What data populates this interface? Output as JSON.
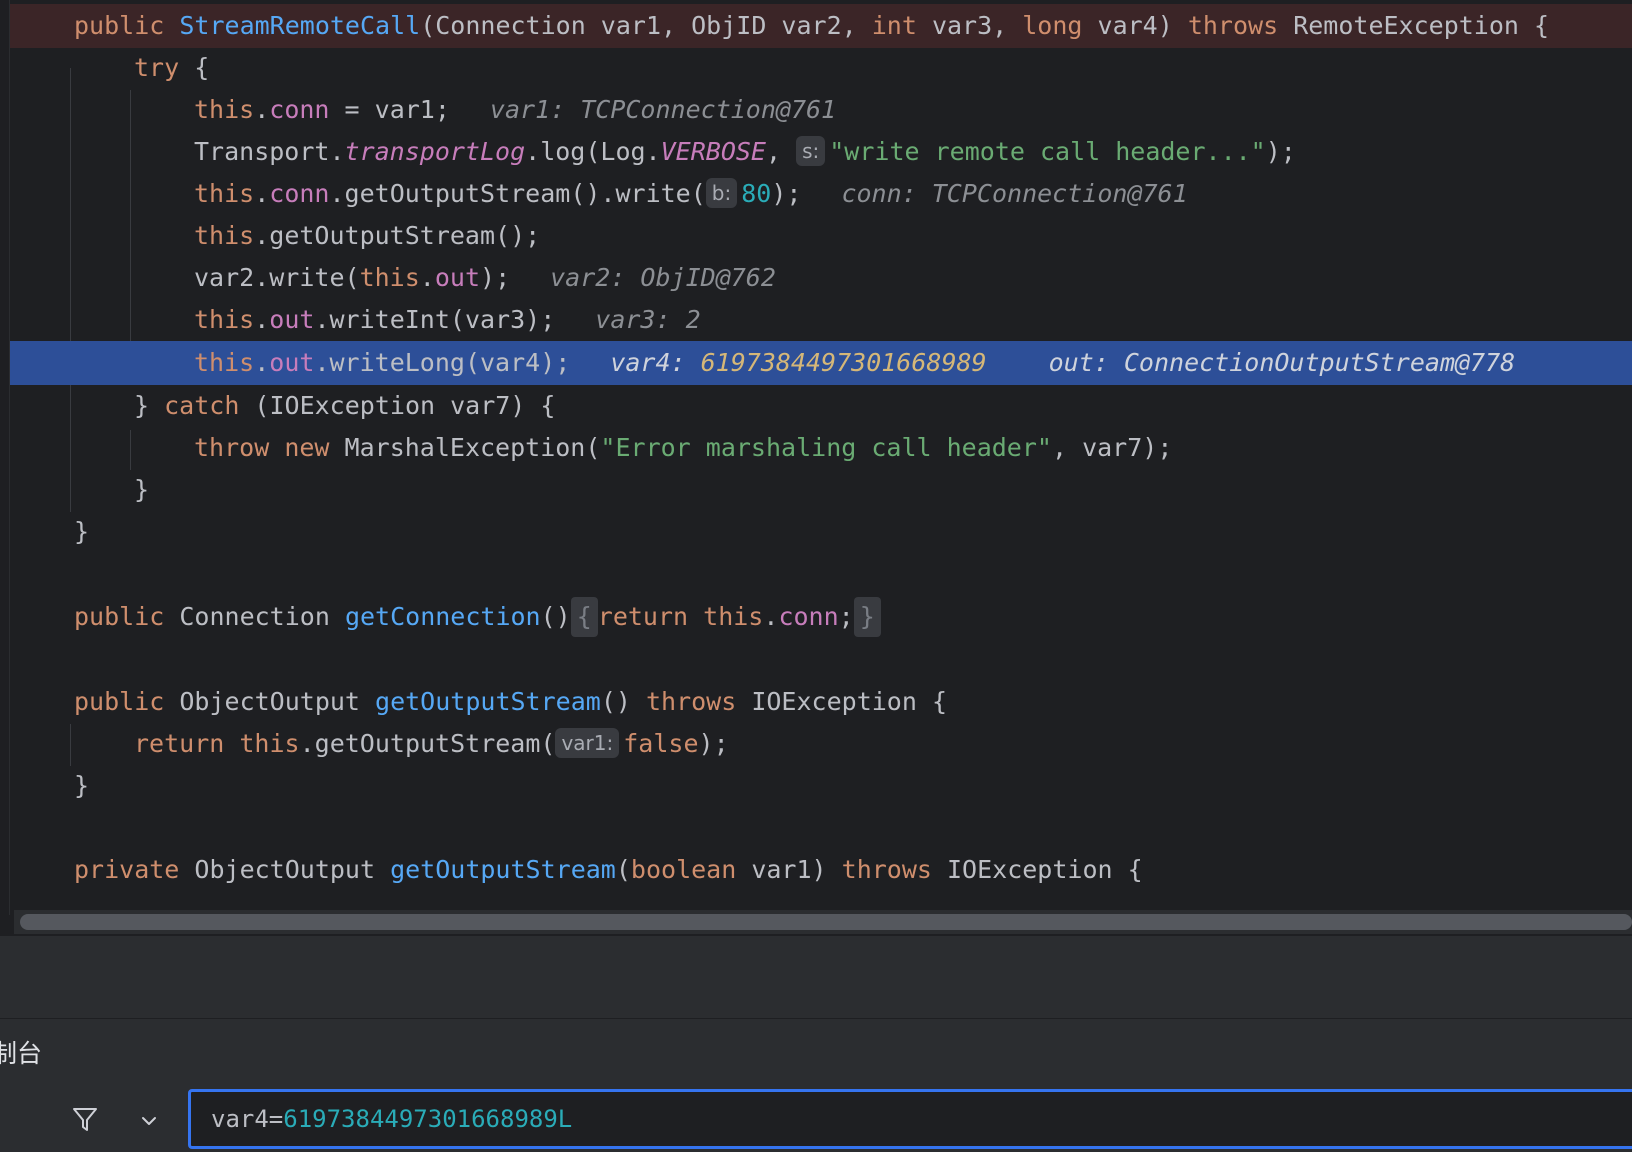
{
  "editor": {
    "lines": [
      {
        "t1": "public ",
        "t2": "StreamRemoteCall",
        "t3": "(Connection var1, ObjID var2, ",
        "t4": "int",
        "t5": " var3, ",
        "t6": "long",
        "t7": " var4) ",
        "t8": "throws",
        "t9": " RemoteException {"
      },
      {
        "t1": "try",
        "t2": " {"
      },
      {
        "t1": "this",
        "t2": ".",
        "t3": "conn",
        "t4": " = var1;",
        "hint": "var1: TCPConnection@761"
      },
      {
        "t1": "Transport.",
        "t2": "transportLog",
        "t3": ".log(Log.",
        "t4": "VERBOSE",
        "t5": ", ",
        "inlay": "s:",
        "t6": "\"write remote call header...\"",
        "t7": ");"
      },
      {
        "t1": "this",
        "t2": ".",
        "t3": "conn",
        "t4": ".getOutputStream().write(",
        "inlay": "b:",
        "t5": "80",
        "t6": ");",
        "hint": "conn: TCPConnection@761"
      },
      {
        "t1": "this",
        "t2": ".getOutputStream();"
      },
      {
        "t1": "var2.write(",
        "t2": "this",
        "t3": ".",
        "t4": "out",
        "t5": ");",
        "hint": "var2: ObjID@762"
      },
      {
        "t1": "this",
        "t2": ".",
        "t3": "out",
        "t4": ".writeInt(var3);",
        "hint": "var3: 2"
      },
      {
        "t1": "this",
        "t2": ".",
        "t3": "out",
        "t4": ".writeLong(var4);",
        "hint_a": "var4: ",
        "hint_b": "6197384497301668989",
        "hint_c": "out: ConnectionOutputStream@778"
      },
      {
        "t1": "} ",
        "t2": "catch",
        "t3": " (IOException var7) {"
      },
      {
        "t1": "throw",
        "t2": " ",
        "t3": "new",
        "t4": " MarshalException(",
        "t5": "\"Error marshaling call header\"",
        "t6": ", var7);"
      },
      {
        "t1": "}"
      },
      {
        "t1": "}"
      },
      {
        "t1": "public",
        "t2": " Connection ",
        "t3": "getConnection",
        "t4": "()",
        "f1": "{",
        "t5": "return",
        "t6": " ",
        "t7": "this",
        "t8": ".",
        "t9": "conn",
        "t10": ";",
        "f2": "}"
      },
      {
        "t1": "public",
        "t2": " ObjectOutput ",
        "t3": "getOutputStream",
        "t4": "() ",
        "t5": "throws",
        "t6": " IOException {"
      },
      {
        "t1": "return",
        "t2": " ",
        "t3": "this",
        "t4": ".getOutputStream(",
        "inlay": "var1:",
        "t5": "false",
        "t6": ");"
      },
      {
        "t1": "}"
      },
      {
        "t1": "private",
        "t2": " ObjectOutput ",
        "t3": "getOutputStream",
        "t4": "(",
        "t5": "boolean",
        "t6": " var1) ",
        "t7": "throws",
        "t8": " IOException {"
      }
    ]
  },
  "console": {
    "title": "制台"
  },
  "expression": {
    "name": "var4=",
    "value": "6197384497301668989L"
  },
  "icons": {
    "filter": "filter-icon",
    "chevron": "chevron-down-icon"
  },
  "colors": {
    "background": "#1e1f22",
    "keyword": "#cf8e6d",
    "function": "#56a8f5",
    "field": "#c77dbb",
    "string": "#6aab73",
    "number": "#2aacb8",
    "current_line": "#2d4f98",
    "breakpoint_line": "#3b2527",
    "focus_border": "#3574f0"
  }
}
